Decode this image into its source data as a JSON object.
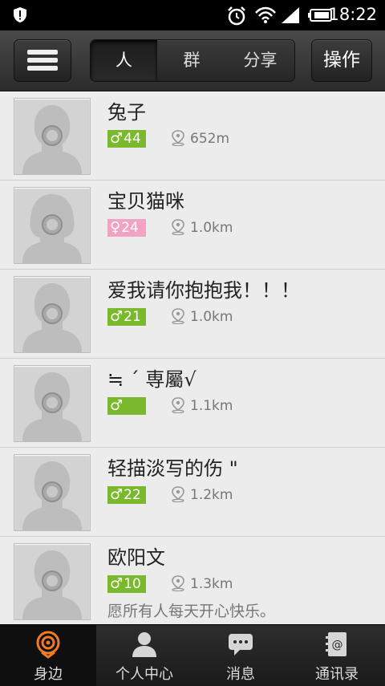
{
  "status_bar": {
    "time": "18:22",
    "icons": [
      "shield-icon",
      "alarm-clock-icon",
      "wifi-icon",
      "signal-icon",
      "battery-icon"
    ]
  },
  "top_bar": {
    "menu_icon": "hamburger-menu-icon",
    "tabs": [
      {
        "label": "人",
        "active": true
      },
      {
        "label": "群",
        "active": false
      },
      {
        "label": "分享",
        "active": false
      }
    ],
    "action_label": "操作"
  },
  "people": [
    {
      "name": "兔子",
      "gender": "male",
      "gender_symbol": "♂",
      "age": "44",
      "distance": "652m",
      "signature": ""
    },
    {
      "name": "宝贝猫咪",
      "gender": "female",
      "gender_symbol": "♀",
      "age": "24",
      "distance": "1.0km",
      "signature": ""
    },
    {
      "name": "爱我请你抱抱我！！！",
      "gender": "male",
      "gender_symbol": "♂",
      "age": "21",
      "distance": "1.0km",
      "signature": ""
    },
    {
      "name": "≒ ˊ 専屬√",
      "gender": "male",
      "gender_symbol": "♂",
      "age": "",
      "distance": "1.1km",
      "signature": ""
    },
    {
      "name": "轻描淡写的伤 \"",
      "gender": "male",
      "gender_symbol": "♂",
      "age": "22",
      "distance": "1.2km",
      "signature": ""
    },
    {
      "name": "欧阳文",
      "gender": "male",
      "gender_symbol": "♂",
      "age": "10",
      "distance": "1.3km",
      "signature": "愿所有人每天开心快乐。"
    }
  ],
  "bottom_nav": [
    {
      "label": "身边",
      "icon": "nearby-radar-icon",
      "active": true
    },
    {
      "label": "个人中心",
      "icon": "person-icon",
      "active": false
    },
    {
      "label": "消息",
      "icon": "chat-bubble-icon",
      "active": false
    },
    {
      "label": "通讯录",
      "icon": "address-book-icon",
      "active": false
    }
  ],
  "colors": {
    "male_badge": "#7ab82e",
    "female_badge": "#f2a3c4",
    "active_nav_icon": "#f07b22"
  }
}
